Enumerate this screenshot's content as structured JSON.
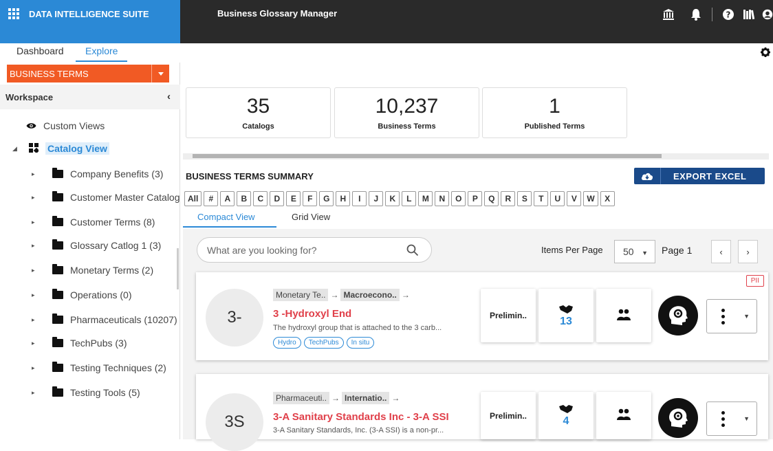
{
  "topbar": {
    "brand": "DATA INTELLIGENCE SUITE",
    "app_title": "Business Glossary Manager",
    "icons": [
      "bank-icon",
      "bell-icon",
      "help-icon",
      "library-icon",
      "user-icon"
    ]
  },
  "tabs": [
    "Dashboard",
    "Explore"
  ],
  "active_tab": "Explore",
  "left": {
    "dropdown": "BUSINESS TERMS",
    "workspace": "Workspace",
    "custom_views": "Custom Views",
    "catalog_view": "Catalog View",
    "folders": [
      "Company Benefits (3)",
      "Customer Master Catalog",
      "Customer Terms (8)",
      "Glossary Catlog 1 (3)",
      "Monetary Terms (2)",
      "Operations (0)",
      "Pharmaceuticals (10207)",
      "TechPubs (3)",
      "Testing Techniques (2)",
      "Testing Tools (5)"
    ]
  },
  "kpis": [
    {
      "value": "35",
      "label": "Catalogs"
    },
    {
      "value": "10,237",
      "label": "Business Terms"
    },
    {
      "value": "1",
      "label": "Published Terms"
    }
  ],
  "summary": {
    "title": "BUSINESS TERMS SUMMARY",
    "export": "EXPORT EXCEL",
    "letters": [
      "All",
      "#",
      "A",
      "B",
      "C",
      "D",
      "E",
      "F",
      "G",
      "H",
      "I",
      "J",
      "K",
      "L",
      "M",
      "N",
      "O",
      "P",
      "Q",
      "R",
      "S",
      "T",
      "U",
      "V",
      "W",
      "X"
    ],
    "view_tabs": [
      "Compact View",
      "Grid View"
    ],
    "search_placeholder": "What are you looking for?",
    "items_per_page_label": "Items Per Page",
    "items_per_page": "50",
    "page": "Page 1"
  },
  "cards": [
    {
      "avatar": "3-",
      "crumb1": "Monetary Te..",
      "crumb2": "Macroecono..",
      "term": "3 -Hydroxyl End",
      "desc": "The hydroxyl group that is attached to the 3 carb...",
      "tags": [
        "Hydro",
        "TechPubs",
        "In situ"
      ],
      "status": "Prelimin..",
      "count": "13",
      "pii": "PII"
    },
    {
      "avatar": "3S",
      "crumb1": "Pharmaceuti..",
      "crumb2": "Internatio..",
      "term": "3-A Sanitary Standards Inc - 3-A SSI",
      "desc": "3-A Sanitary Standards, Inc. (3-A SSI) is a non-pr...",
      "tags": [],
      "status": "Prelimin..",
      "count": "4"
    }
  ]
}
